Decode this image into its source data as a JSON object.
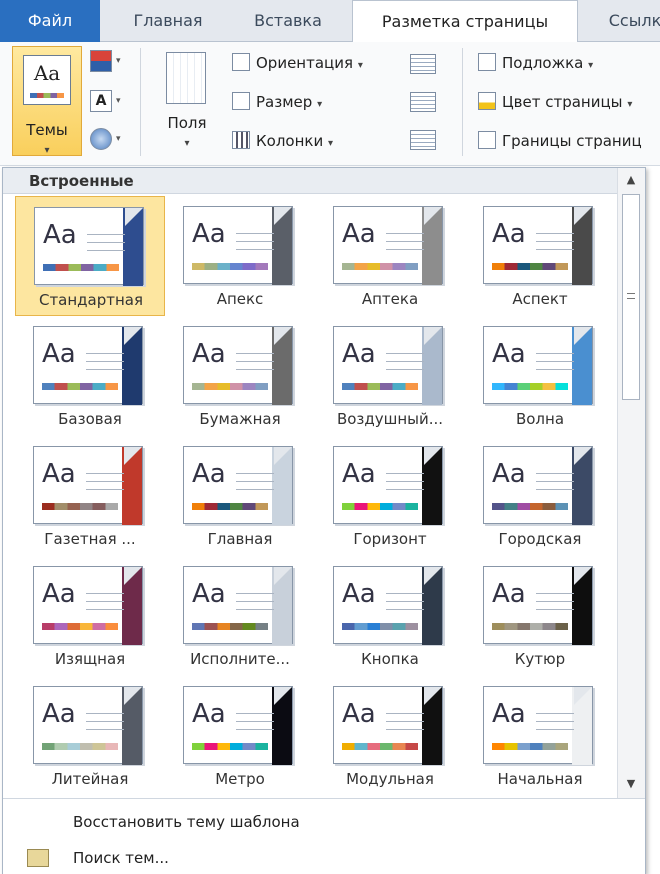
{
  "tabs": {
    "file": "Файл",
    "home": "Главная",
    "insert": "Вставка",
    "layout": "Разметка страницы",
    "links": "Ссылк"
  },
  "ribbon": {
    "themes": "Темы",
    "margins": "Поля",
    "orientation": "Ориентация",
    "size": "Размер",
    "columns": "Колонки",
    "watermark": "Подложка",
    "page_color": "Цвет страницы",
    "page_borders": "Границы страниц"
  },
  "gallery": {
    "header": "Встроенные",
    "themes": [
      {
        "label": "Стандартная",
        "accent": "#2e4d8f",
        "stripe": [
          "#3f6fb5",
          "#c0504d",
          "#9bbb59",
          "#8064a2",
          "#4bacc6",
          "#f79646"
        ],
        "selected": true
      },
      {
        "label": "Апекс",
        "accent": "#5a5f68",
        "stripe": [
          "#ceb966",
          "#9cb084",
          "#6bb1c9",
          "#6585cf",
          "#7e6bc9",
          "#a379bb"
        ]
      },
      {
        "label": "Аптека",
        "accent": "#8d8d8d",
        "stripe": [
          "#a5b592",
          "#f3a447",
          "#e7bc29",
          "#d092a7",
          "#9c85c0",
          "#809ec2"
        ]
      },
      {
        "label": "Аспект",
        "accent": "#4a4a4a",
        "stripe": [
          "#f07f09",
          "#9f2936",
          "#1b587c",
          "#4e8542",
          "#604878",
          "#c19859"
        ]
      },
      {
        "label": "Базовая",
        "accent": "#1f3a6e",
        "stripe": [
          "#4f81bd",
          "#c0504d",
          "#9bbb59",
          "#8064a2",
          "#4bacc6",
          "#f79646"
        ]
      },
      {
        "label": "Бумажная",
        "accent": "#6b6b6b",
        "stripe": [
          "#a5b592",
          "#f3a447",
          "#e7bc29",
          "#d092a7",
          "#9c85c0",
          "#809ec2"
        ]
      },
      {
        "label": "Воздушный...",
        "accent": "#aab9cc",
        "stripe": [
          "#4f81bd",
          "#c0504d",
          "#9bbb59",
          "#8064a2",
          "#4bacc6",
          "#f79646"
        ]
      },
      {
        "label": "Волна",
        "accent": "#4a8fd0",
        "stripe": [
          "#31b6fd",
          "#4584d3",
          "#5bd078",
          "#a5d028",
          "#f5c040",
          "#05e0db"
        ]
      },
      {
        "label": "Газетная ...",
        "accent": "#c0392b",
        "stripe": [
          "#9b2d1f",
          "#a28e6a",
          "#956251",
          "#918485",
          "#855d5d",
          "#a9a9a9"
        ]
      },
      {
        "label": "Главная",
        "accent": "#c9d3de",
        "stripe": [
          "#f07f09",
          "#9f2936",
          "#1b587c",
          "#4e8542",
          "#604878",
          "#c19859"
        ]
      },
      {
        "label": "Горизонт",
        "accent": "#111111",
        "stripe": [
          "#7fd13b",
          "#ea157a",
          "#feb80a",
          "#00addc",
          "#738ac8",
          "#1ab39f"
        ]
      },
      {
        "label": "Городская",
        "accent": "#3c4a66",
        "stripe": [
          "#53548a",
          "#438086",
          "#a04da3",
          "#c4652d",
          "#8b5d3d",
          "#5c92b5"
        ]
      },
      {
        "label": "Изящная",
        "accent": "#6e2a4a",
        "stripe": [
          "#b83d68",
          "#ac66bb",
          "#de6c36",
          "#f9b639",
          "#cf6da4",
          "#fa8d3d"
        ]
      },
      {
        "label": "Исполните...",
        "accent": "#c8d0da",
        "stripe": [
          "#6076b4",
          "#9c5252",
          "#e68422",
          "#846648",
          "#63891f",
          "#758085"
        ]
      },
      {
        "label": "Кнопка",
        "accent": "#2e3a4a",
        "stripe": [
          "#4a66ac",
          "#629dd1",
          "#297fd5",
          "#7f8fa9",
          "#5aa2ae",
          "#9d90a0"
        ]
      },
      {
        "label": "Кутюр",
        "accent": "#0e0e0e",
        "stripe": [
          "#9e8e5c",
          "#a09781",
          "#85776d",
          "#aeafa9",
          "#8d878b",
          "#6b6149"
        ]
      },
      {
        "label": "Литейная",
        "accent": "#555b66",
        "stripe": [
          "#72a376",
          "#b0ccb0",
          "#a8cdd7",
          "#c0beaf",
          "#cec597",
          "#e8b7b7"
        ]
      },
      {
        "label": "Метро",
        "accent": "#0b0b12",
        "stripe": [
          "#7fd13b",
          "#ea157a",
          "#feb80a",
          "#00addc",
          "#738ac8",
          "#1ab39f"
        ]
      },
      {
        "label": "Модульная",
        "accent": "#101010",
        "stripe": [
          "#f0ad00",
          "#60b5cc",
          "#e66c7d",
          "#6bb76d",
          "#e88651",
          "#c64847"
        ]
      },
      {
        "label": "Начальная",
        "accent": "#eef0f2",
        "stripe": [
          "#ff8600",
          "#e6c300",
          "#7ba0cd",
          "#4f81bd",
          "#93a299",
          "#a9a57c"
        ]
      }
    ]
  },
  "footer": {
    "reset": "Восстановить тему шаблона",
    "find": "Поиск тем..."
  },
  "colors": {
    "file_tab": "#2a6fc0",
    "selection": "#fde6a0",
    "selection_border": "#e8b54a"
  }
}
